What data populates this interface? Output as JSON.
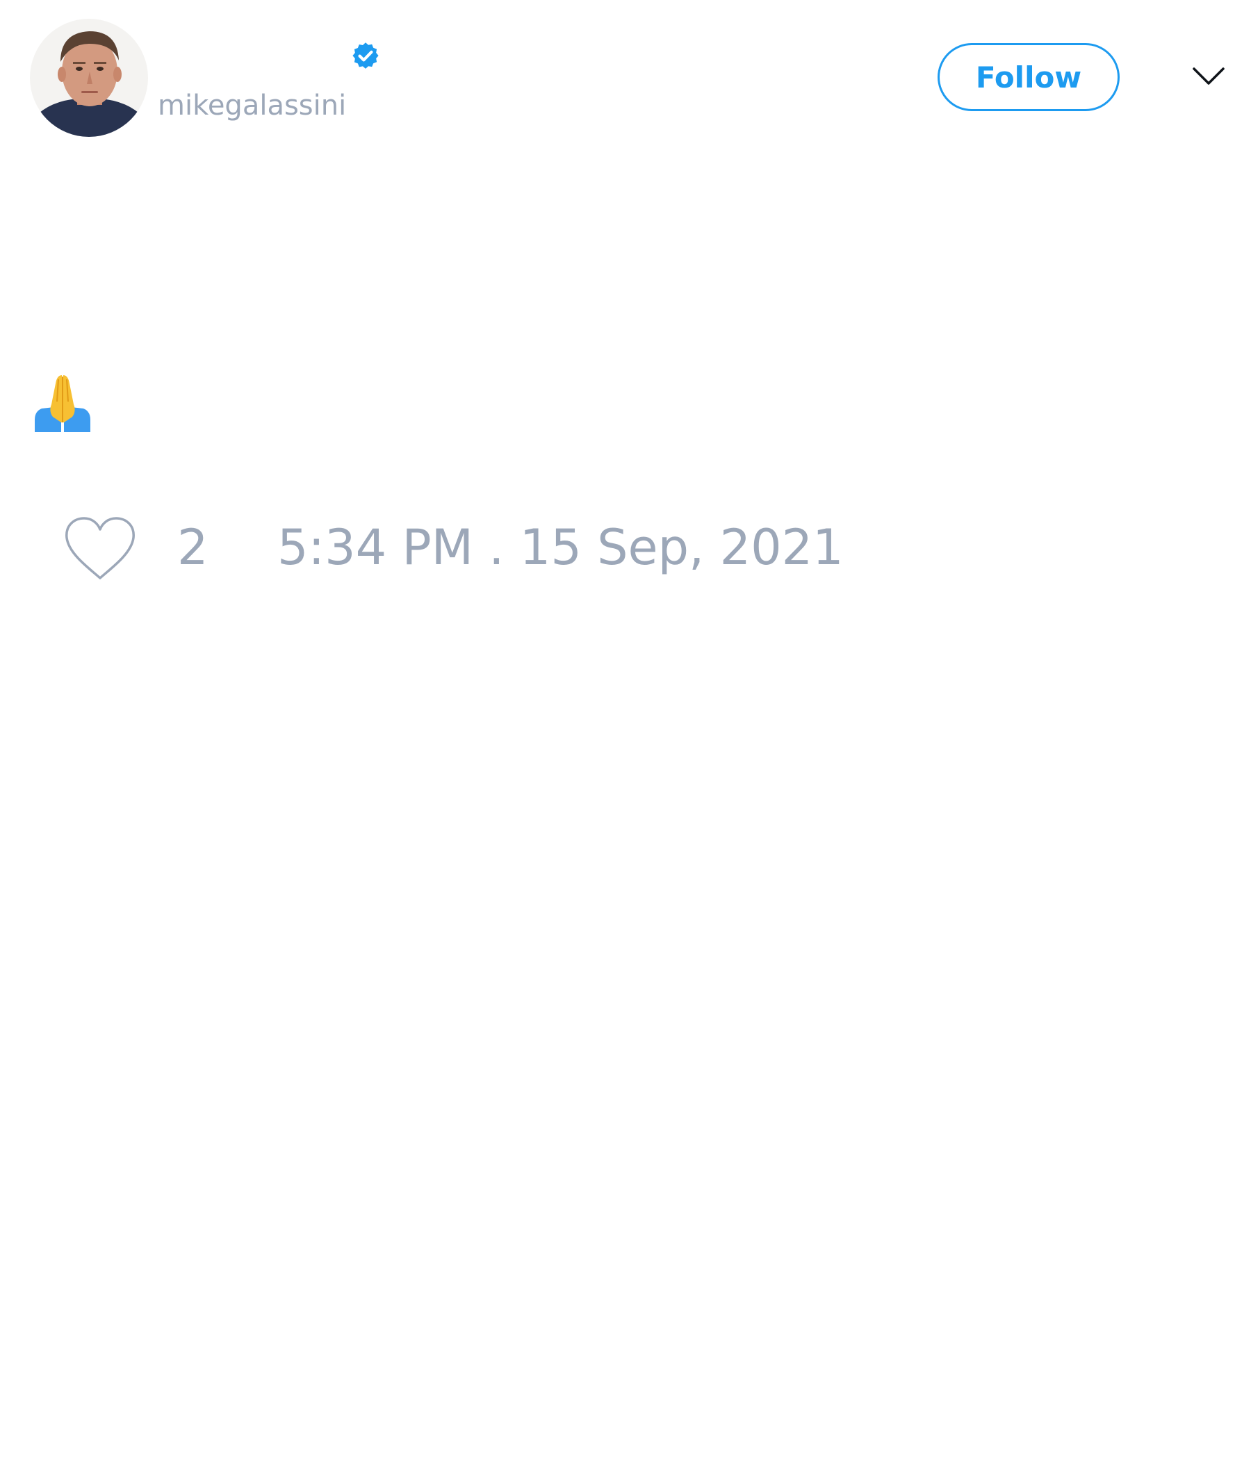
{
  "author": {
    "username": "mikegalassini",
    "verified": true,
    "verified_color": "#1d9bf0",
    "avatar_icon": "profile-photo"
  },
  "header": {
    "follow_label": "Follow",
    "menu_icon": "chevron-down-icon"
  },
  "tweet": {
    "body_emoji": "folded-hands-emoji",
    "like_count": "2",
    "timestamp": "5:34 PM . 15 Sep, 2021"
  },
  "colors": {
    "accent": "#1d9bf0",
    "muted_text": "#9ca7b8",
    "background": "#ffffff"
  }
}
